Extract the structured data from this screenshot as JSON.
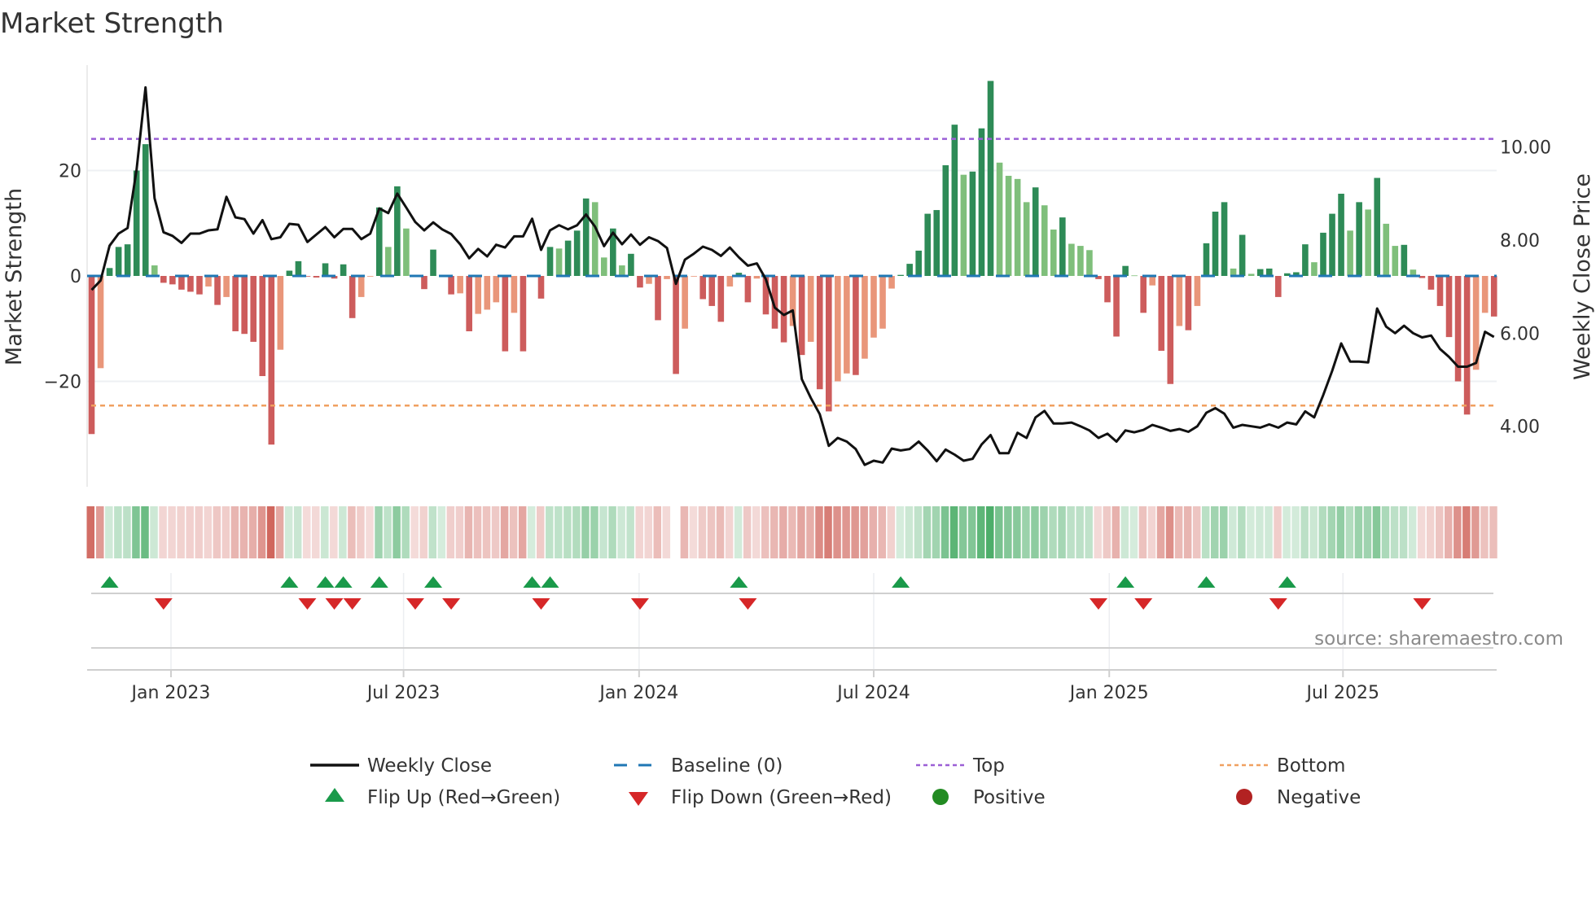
{
  "title": "Market Strength",
  "source": "source: sharemaestro.com",
  "colors": {
    "strong_green": "#2e8b57",
    "weak_green": "#7fbf7b",
    "strong_red": "#cd5c5c",
    "weak_red": "#e9967a",
    "close_line": "#111111",
    "baseline": "#1f77b4",
    "top": "#9b5fd6",
    "bottom": "#f0a060",
    "flip_up": "#1a9a4a",
    "flip_down": "#d62728",
    "positive": "#228b22",
    "negative": "#b22222"
  },
  "chart_data": {
    "type": "bar",
    "title": "Market Strength",
    "xlabel": "",
    "ylabel": "Market Strength",
    "y2label": "Weekly Close Price",
    "ylim": [
      -40,
      40
    ],
    "y2lim": [
      2.7,
      11.76
    ],
    "grid": true,
    "legend_placement": "bottom",
    "top_level": 26,
    "bottom_level": -24.6,
    "yticks": [
      {
        "v": 20,
        "label": "20"
      },
      {
        "v": 0,
        "label": "0"
      },
      {
        "v": -20,
        "label": "−20"
      }
    ],
    "y2ticks": [
      {
        "v": 10,
        "label": "10.00"
      },
      {
        "v": 8,
        "label": "8.00"
      },
      {
        "v": 6,
        "label": "6.00"
      },
      {
        "v": 4,
        "label": "4.00"
      }
    ],
    "xticks": [
      {
        "week": 8.83,
        "label": "Jan 2023"
      },
      {
        "week": 34.7,
        "label": "Jul 2023"
      },
      {
        "week": 60.9,
        "label": "Jan 2024"
      },
      {
        "week": 87.0,
        "label": "Jul 2024"
      },
      {
        "week": 113.2,
        "label": "Jan 2025"
      },
      {
        "week": 139.2,
        "label": "Jul 2025"
      }
    ],
    "strength": [
      -30,
      -17.5,
      1.5,
      5.5,
      6,
      20,
      25,
      2,
      -1.3,
      -1.6,
      -2.6,
      -3,
      -3.5,
      -2,
      -5.5,
      -4,
      -10.5,
      -11,
      -12.5,
      -19,
      -32,
      -14,
      1,
      2.8,
      -0.1,
      -0.3,
      2.4,
      -0.5,
      2.2,
      -8,
      -4,
      -0.1,
      13,
      5.5,
      17,
      9,
      -0.2,
      -2.5,
      5,
      0.1,
      -3.5,
      -3.3,
      -10.5,
      -7.2,
      -6.4,
      -5,
      -14.3,
      -7,
      -14.3,
      0.2,
      -4.3,
      5.5,
      5.2,
      6.7,
      8.6,
      14.7,
      14,
      3.5,
      9,
      2,
      4.2,
      -2.2,
      -1.5,
      -8.4,
      -0.6,
      -18.6,
      -10,
      -0.1,
      -4.4,
      -5.7,
      -8.7,
      -2,
      0.6,
      -5,
      -0.5,
      -7.3,
      -10,
      -12.6,
      -9.5,
      -15,
      -12.5,
      -21.5,
      -25.7,
      -20,
      -18.5,
      -18.8,
      -15.7,
      -11.7,
      -10,
      -2.4,
      0.2,
      2.3,
      4.8,
      11.8,
      12.5,
      21,
      28.7,
      19.2,
      19.8,
      28,
      37,
      21.5,
      19,
      18.4,
      14,
      16.8,
      13.4,
      8.8,
      11.1,
      6.1,
      5.7,
      4.9,
      -0.6,
      -5,
      -11.5,
      1.9,
      0.1,
      -7,
      -1.8,
      -14.2,
      -20.5,
      -9.5,
      -10.3,
      -5.7,
      6.2,
      12.2,
      14,
      1.4,
      7.8,
      0.4,
      1.3,
      1.4,
      -4,
      0.5,
      0.7,
      6,
      2.6,
      8.2,
      11.8,
      15.6,
      8.6,
      14,
      12.6,
      18.6,
      9.9,
      5.7,
      5.9,
      1.2,
      -0.4,
      -2.6,
      -5.7,
      -11.6,
      -20,
      -26.3,
      -17.8,
      -7,
      -7.7
    ],
    "weekly_close": [
      6.93,
      7.13,
      7.88,
      8.14,
      8.26,
      9.51,
      11.28,
      8.9,
      8.17,
      8.09,
      7.94,
      8.14,
      8.14,
      8.21,
      8.23,
      8.93,
      8.49,
      8.45,
      8.14,
      8.43,
      8.02,
      8.06,
      8.35,
      8.33,
      7.96,
      8.12,
      8.28,
      8.06,
      8.24,
      8.24,
      8.02,
      8.14,
      8.68,
      8.58,
      9.0,
      8.7,
      8.39,
      8.21,
      8.38,
      8.23,
      8.13,
      7.91,
      7.61,
      7.81,
      7.65,
      7.9,
      7.84,
      8.08,
      8.08,
      8.46,
      7.79,
      8.21,
      8.32,
      8.23,
      8.32,
      8.55,
      8.29,
      7.87,
      8.16,
      7.91,
      8.12,
      7.9,
      8.06,
      7.98,
      7.83,
      7.06,
      7.58,
      7.71,
      7.86,
      7.79,
      7.66,
      7.84,
      7.63,
      7.45,
      7.5,
      7.16,
      6.55,
      6.39,
      6.49,
      5.01,
      4.61,
      4.26,
      3.58,
      3.75,
      3.67,
      3.51,
      3.17,
      3.26,
      3.22,
      3.52,
      3.48,
      3.51,
      3.67,
      3.48,
      3.25,
      3.5,
      3.39,
      3.26,
      3.3,
      3.61,
      3.81,
      3.42,
      3.42,
      3.86,
      3.75,
      4.19,
      4.33,
      4.06,
      4.06,
      4.08,
      4.0,
      3.91,
      3.75,
      3.84,
      3.67,
      3.91,
      3.87,
      3.92,
      4.03,
      3.97,
      3.9,
      3.94,
      3.88,
      4.0,
      4.29,
      4.39,
      4.27,
      3.97,
      4.03,
      4.0,
      3.97,
      4.04,
      3.97,
      4.08,
      4.04,
      4.32,
      4.19,
      4.67,
      5.19,
      5.78,
      5.39,
      5.39,
      5.37,
      6.53,
      6.14,
      6.0,
      6.16,
      6.0,
      5.91,
      5.95,
      5.66,
      5.49,
      5.28,
      5.28,
      5.36,
      6.03,
      5.92
    ],
    "legend": [
      {
        "key": "close",
        "label": "Weekly Close"
      },
      {
        "key": "baseline",
        "label": "Baseline (0)"
      },
      {
        "key": "top",
        "label": "Top"
      },
      {
        "key": "bottom",
        "label": "Bottom"
      },
      {
        "key": "flip_up",
        "label": "Flip Up (Red→Green)"
      },
      {
        "key": "flip_down",
        "label": "Flip Down (Green→Red)"
      },
      {
        "key": "positive",
        "label": "Positive"
      },
      {
        "key": "negative",
        "label": "Negative"
      }
    ]
  }
}
